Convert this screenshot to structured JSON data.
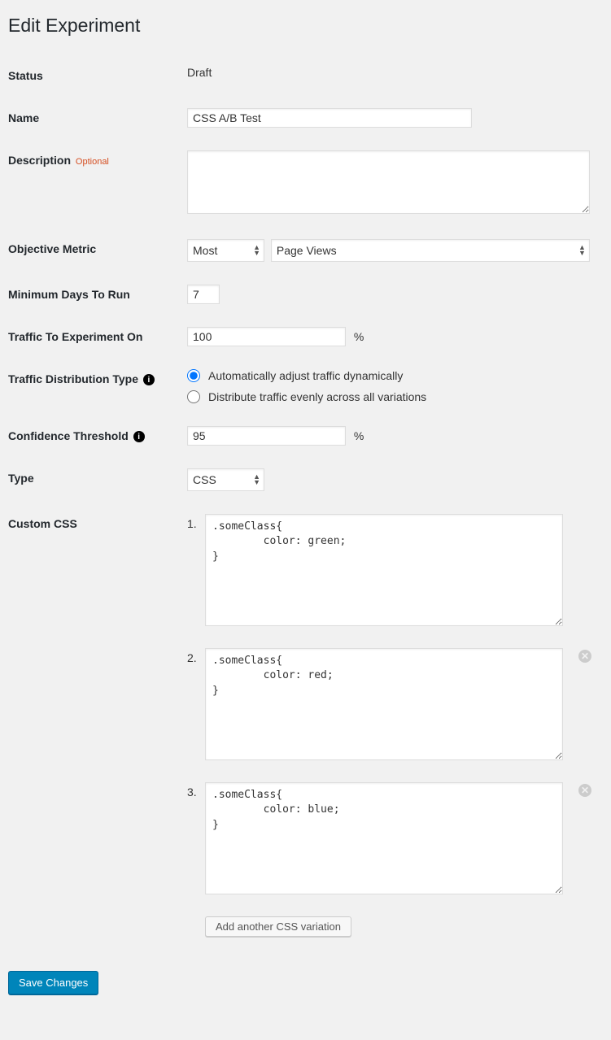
{
  "page": {
    "title": "Edit Experiment"
  },
  "labels": {
    "status": "Status",
    "name": "Name",
    "description": "Description",
    "optional": "Optional",
    "objectiveMetric": "Objective Metric",
    "minDays": "Minimum Days To Run",
    "trafficPct": "Traffic To Experiment On",
    "trafficDist": "Traffic Distribution Type",
    "confidence": "Confidence Threshold",
    "type": "Type",
    "customCss": "Custom CSS"
  },
  "status": {
    "value": "Draft"
  },
  "name": {
    "value": "CSS A/B Test"
  },
  "description": {
    "value": ""
  },
  "objective": {
    "direction": "Most",
    "metric": "Page Views"
  },
  "minDays": {
    "value": "7"
  },
  "trafficPct": {
    "value": "100",
    "unit": "%"
  },
  "trafficDist": {
    "selected": "auto",
    "options": {
      "auto": "Automatically adjust traffic dynamically",
      "even": "Distribute traffic evenly across all variations"
    }
  },
  "confidence": {
    "value": "95",
    "unit": "%"
  },
  "type": {
    "value": "CSS"
  },
  "css": {
    "items": [
      {
        "num": "1.",
        "code": ".someClass{\n        color: green;\n}",
        "removable": false
      },
      {
        "num": "2.",
        "code": ".someClass{\n        color: red;\n}",
        "removable": true
      },
      {
        "num": "3.",
        "code": ".someClass{\n        color: blue;\n}",
        "removable": true
      }
    ],
    "addLabel": "Add another CSS variation"
  },
  "submit": {
    "label": "Save Changes"
  }
}
